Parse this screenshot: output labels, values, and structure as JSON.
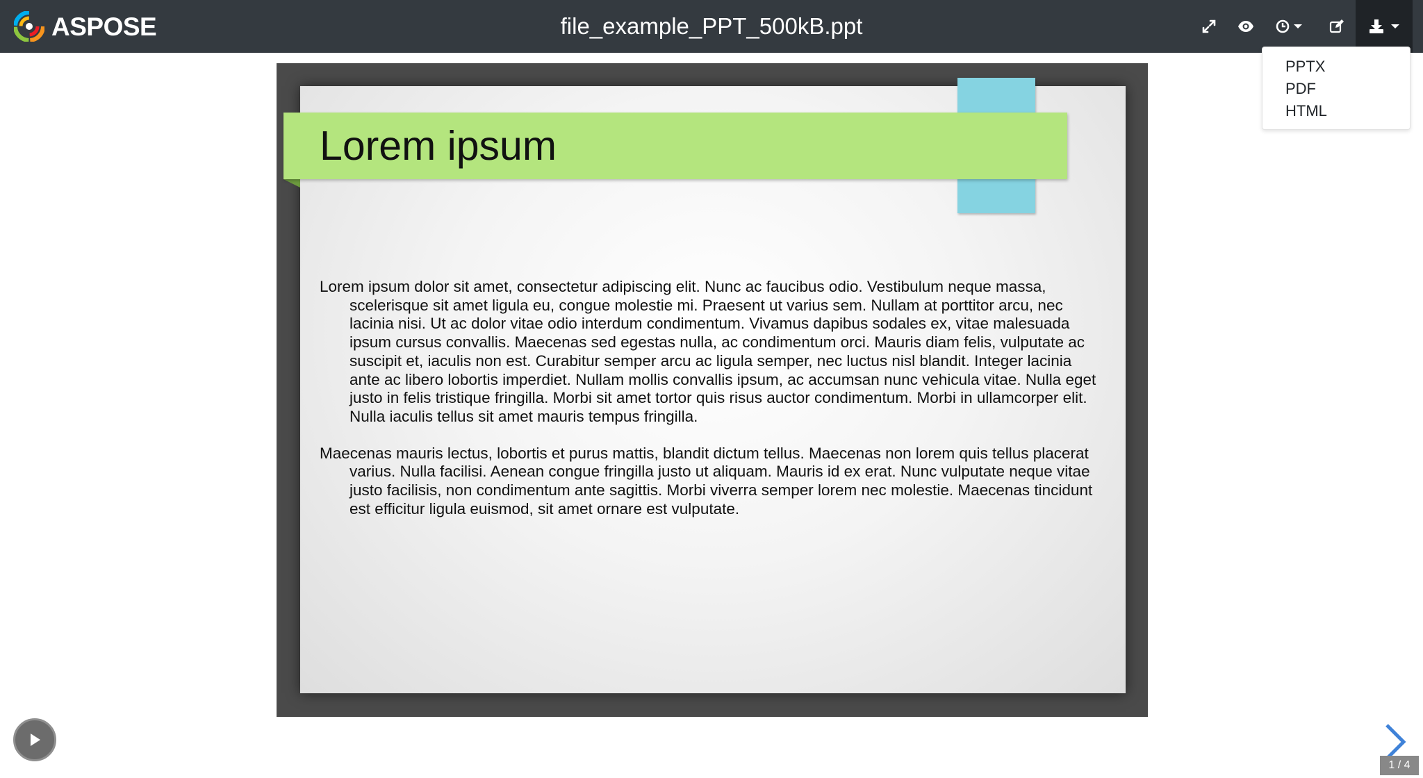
{
  "header": {
    "logo_text": "ASPOSE",
    "file_name": "file_example_PPT_500kB.ppt",
    "tools": [
      {
        "icon": "expand-icon"
      },
      {
        "icon": "eye-icon"
      },
      {
        "icon": "clock-icon"
      },
      {
        "icon": "edit-icon"
      },
      {
        "icon": "download-icon"
      }
    ]
  },
  "download_menu": {
    "items": [
      "PPTX",
      "PDF",
      "HTML"
    ]
  },
  "slide": {
    "title": "Lorem ipsum",
    "paragraphs": [
      "Lorem ipsum dolor sit amet, consectetur adipiscing elit. Nunc ac faucibus odio. Vestibulum neque massa, scelerisque sit amet ligula eu, congue molestie mi. Praesent ut varius sem. Nullam at porttitor arcu, nec lacinia nisi. Ut ac dolor vitae odio interdum condimentum. Vivamus dapibus sodales ex, vitae malesuada ipsum cursus convallis. Maecenas sed egestas nulla, ac condimentum orci. Mauris diam felis, vulputate ac suscipit et, iaculis non est. Curabitur semper arcu ac ligula semper, nec luctus nisl blandit. Integer lacinia ante ac libero lobortis imperdiet. Nullam mollis convallis ipsum, ac accumsan nunc vehicula vitae. Nulla eget justo in felis tristique fringilla. Morbi sit amet tortor quis risus auctor condimentum. Morbi in ullamcorper elit. Nulla iaculis tellus sit amet mauris tempus fringilla.",
      "Maecenas mauris lectus, lobortis et purus mattis, blandit dictum tellus. Maecenas non lorem quis tellus placerat varius. Nulla facilisi. Aenean congue fringilla justo ut aliquam. Mauris id ex erat. Nunc vulputate neque vitae justo facilisis, non condimentum ante sagittis. Morbi viverra semper lorem nec molestie. Maecenas tincidunt est efficitur ligula euismod, sit amet ornare est vulputate."
    ],
    "colors": {
      "title_band": "#b4e57e",
      "accent_tab": "#85d3e1",
      "frame": "#4a4a4a"
    }
  },
  "navigation": {
    "page_indicator": "1 / 4",
    "play_icon": "play-icon",
    "next_icon": "chevron-right-icon"
  }
}
